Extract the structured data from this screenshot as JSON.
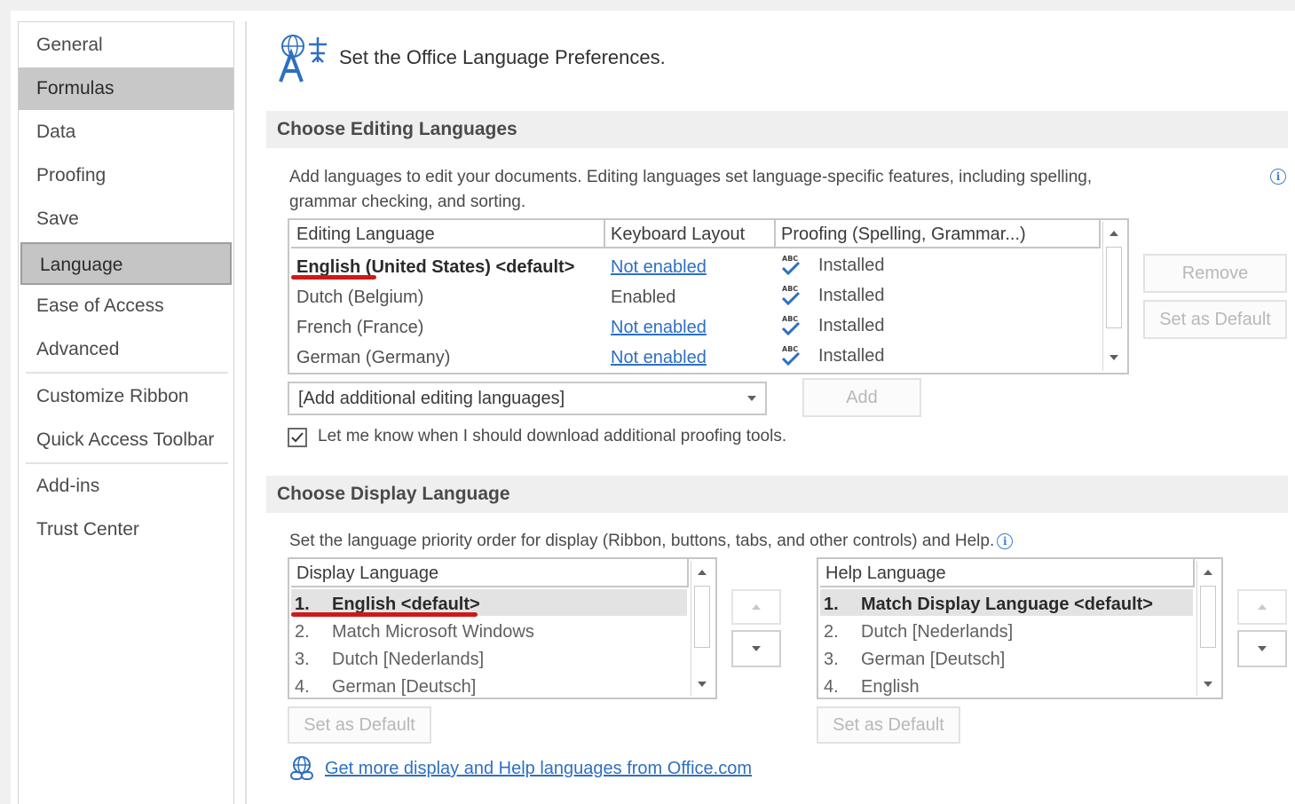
{
  "sidebar": {
    "items": [
      {
        "label": "General"
      },
      {
        "label": "Formulas"
      },
      {
        "label": "Data"
      },
      {
        "label": "Proofing"
      },
      {
        "label": "Save"
      },
      {
        "label": "Language"
      },
      {
        "label": "Ease of Access"
      },
      {
        "label": "Advanced"
      },
      {
        "label": "Customize Ribbon"
      },
      {
        "label": "Quick Access Toolbar"
      },
      {
        "label": "Add-ins"
      },
      {
        "label": "Trust Center"
      }
    ],
    "selected": "Language",
    "hovered": "Formulas"
  },
  "header": {
    "title": "Set the Office Language Preferences."
  },
  "editing": {
    "section_title": "Choose Editing Languages",
    "description_line1": "Add languages to edit your documents. Editing languages set language-specific features, including spelling,",
    "description_line2": "grammar checking, and sorting.",
    "columns": [
      "Editing Language",
      "Keyboard Layout",
      "Proofing (Spelling, Grammar...)"
    ],
    "rows": [
      {
        "language": "English (United States) <default>",
        "keyboard": "Not enabled",
        "keyboard_link": true,
        "proofing": "Installed"
      },
      {
        "language": "Dutch (Belgium)",
        "keyboard": "Enabled",
        "keyboard_link": false,
        "proofing": "Installed"
      },
      {
        "language": "French (France)",
        "keyboard": "Not enabled",
        "keyboard_link": true,
        "proofing": "Installed"
      },
      {
        "language": "German (Germany)",
        "keyboard": "Not enabled",
        "keyboard_link": true,
        "proofing": "Installed"
      }
    ],
    "remove_label": "Remove",
    "set_default_label": "Set as Default",
    "add_dropdown_value": "[Add additional editing languages]",
    "add_label": "Add",
    "checkbox_label": "Let me know when I should download additional proofing tools.",
    "checkbox_checked": true
  },
  "display": {
    "section_title": "Choose Display Language",
    "description": "Set the language priority order for display (Ribbon, buttons, tabs, and other controls) and Help.",
    "display_column": "Display Language",
    "display_items": [
      {
        "num": "1.",
        "label": "English <default>"
      },
      {
        "num": "2.",
        "label": "Match Microsoft Windows"
      },
      {
        "num": "3.",
        "label": "Dutch [Nederlands]"
      },
      {
        "num": "4.",
        "label": "German [Deutsch]"
      }
    ],
    "help_column": "Help Language",
    "help_items": [
      {
        "num": "1.",
        "label": "Match Display Language <default>"
      },
      {
        "num": "2.",
        "label": "Dutch [Nederlands]"
      },
      {
        "num": "3.",
        "label": "German [Deutsch]"
      },
      {
        "num": "4.",
        "label": "English"
      }
    ],
    "set_default_display_label": "Set as Default",
    "set_default_help_label": "Set as Default",
    "more_languages_link": "Get more display and Help languages from Office.com"
  },
  "colors": {
    "link": "#2e6fc2",
    "annotation_red": "#d01818",
    "check_blue": "#2e6fc2"
  }
}
